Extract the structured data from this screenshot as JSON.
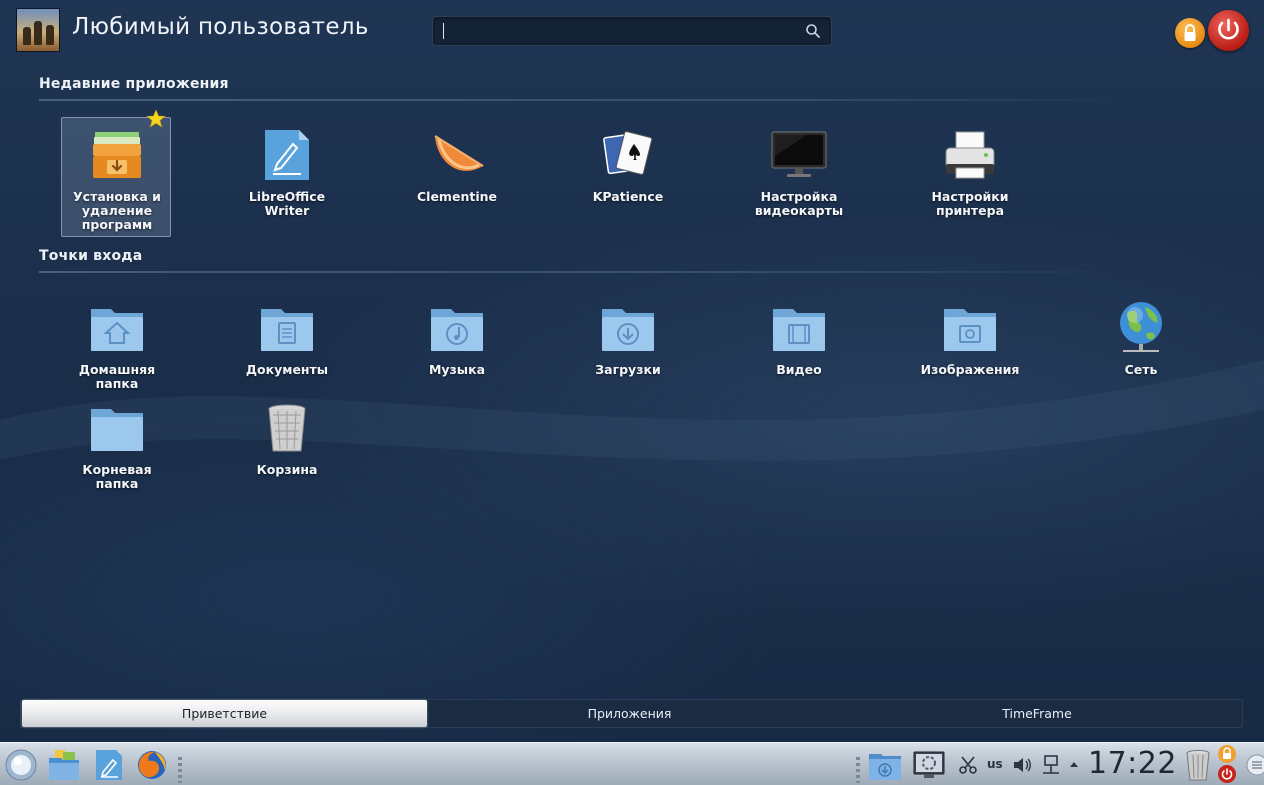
{
  "header": {
    "user_name": "Любимый пользователь",
    "search": {
      "value": "",
      "placeholder": ""
    }
  },
  "recent_apps": {
    "title": "Недавние приложения",
    "items": [
      {
        "label": "Установка и удаление программ",
        "icon": "package-installer-icon",
        "selected": true,
        "favorite": true
      },
      {
        "label": "LibreOffice Writer",
        "icon": "libreoffice-writer-icon"
      },
      {
        "label": "Clementine",
        "icon": "clementine-icon"
      },
      {
        "label": "KPatience",
        "icon": "kpatience-cards-icon"
      },
      {
        "label": "Настройка видеокарты",
        "icon": "monitor-icon"
      },
      {
        "label": "Настройки принтера",
        "icon": "printer-icon"
      }
    ]
  },
  "places": {
    "title": "Точки входа",
    "items": [
      {
        "label": "Домашняя папка",
        "icon": "home-folder-icon"
      },
      {
        "label": "Документы",
        "icon": "documents-folder-icon"
      },
      {
        "label": "Музыка",
        "icon": "music-folder-icon"
      },
      {
        "label": "Загрузки",
        "icon": "downloads-folder-icon"
      },
      {
        "label": "Видео",
        "icon": "video-folder-icon"
      },
      {
        "label": "Изображения",
        "icon": "pictures-folder-icon"
      },
      {
        "label": "Сеть",
        "icon": "network-globe-icon"
      },
      {
        "label": "Корневая папка",
        "icon": "root-folder-icon"
      },
      {
        "label": "Корзина",
        "icon": "trash-icon"
      }
    ]
  },
  "tabs": [
    {
      "label": "Приветствие",
      "active": true
    },
    {
      "label": "Приложения",
      "active": false
    },
    {
      "label": "TimeFrame",
      "active": false
    }
  ],
  "taskbar": {
    "keyboard_layout": "us",
    "clock": "17:22"
  },
  "colors": {
    "background": "#1b2f4b",
    "folder_blue": "#8fbde6",
    "active_tab": "#e4e6e9",
    "power_red": "#c8231a",
    "lock_orange": "#f0a030"
  }
}
